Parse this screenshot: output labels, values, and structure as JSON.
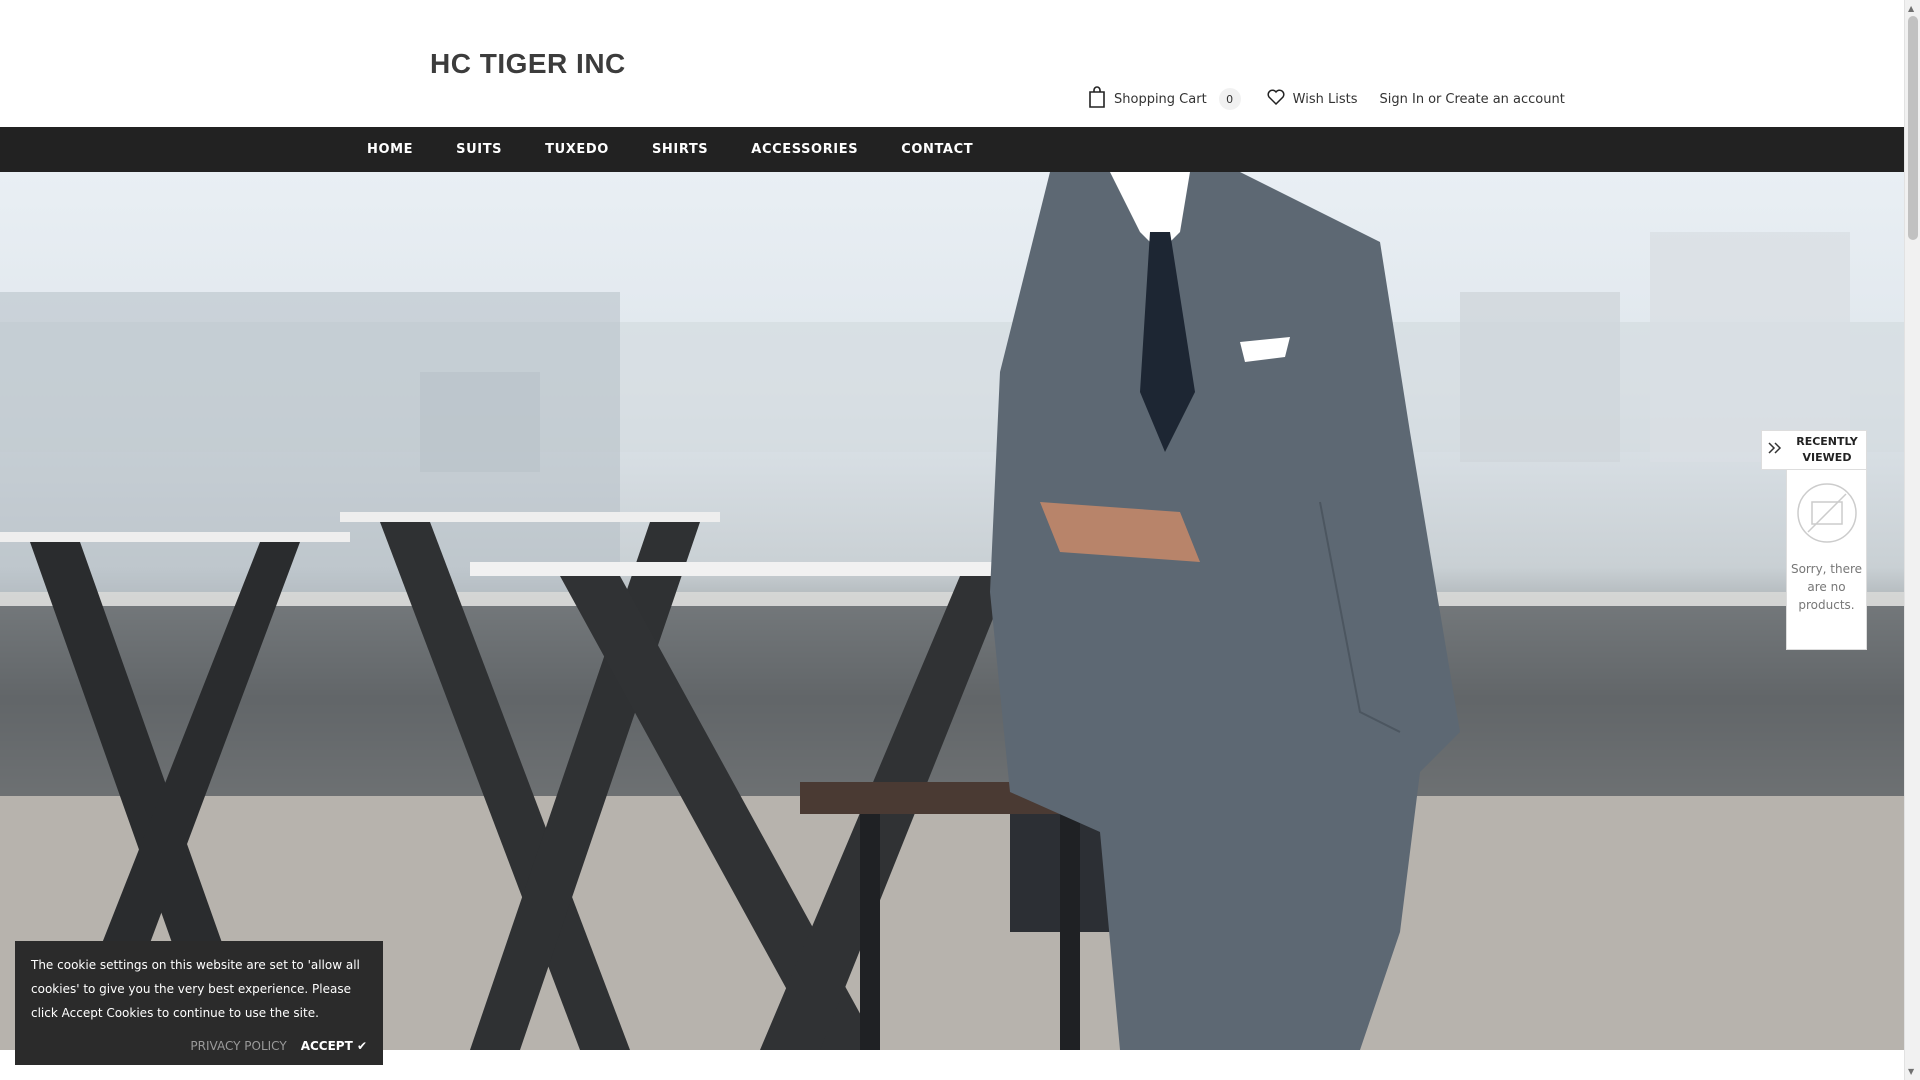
{
  "header": {
    "logo": "HC TIGER INC",
    "cart_label": "Shopping Cart",
    "cart_count": "0",
    "wishlist_label": "Wish Lists",
    "sign_in": "Sign In",
    "or": "or",
    "create_account": "Create an account"
  },
  "nav": {
    "items": [
      "HOME",
      "SUITS",
      "TUXEDO",
      "SHIRTS",
      "ACCESSORIES",
      "CONTACT"
    ]
  },
  "recently_viewed": {
    "title_line1": "RECENTLY",
    "title_line2": "VIEWED",
    "message": "Sorry, there are no products."
  },
  "cookie": {
    "message": "The cookie settings on this website are set to 'allow all cookies' to give you the very best experience. Please click Accept Cookies to continue to use the site.",
    "privacy_label": "PRIVACY POLICY",
    "accept_label": "ACCEPT ✔"
  },
  "icons": {
    "cart": "shopping-bag-icon",
    "wishlist": "heart-icon",
    "recent_toggle": "double-chevron-right-icon",
    "no_image": "no-image-icon"
  }
}
